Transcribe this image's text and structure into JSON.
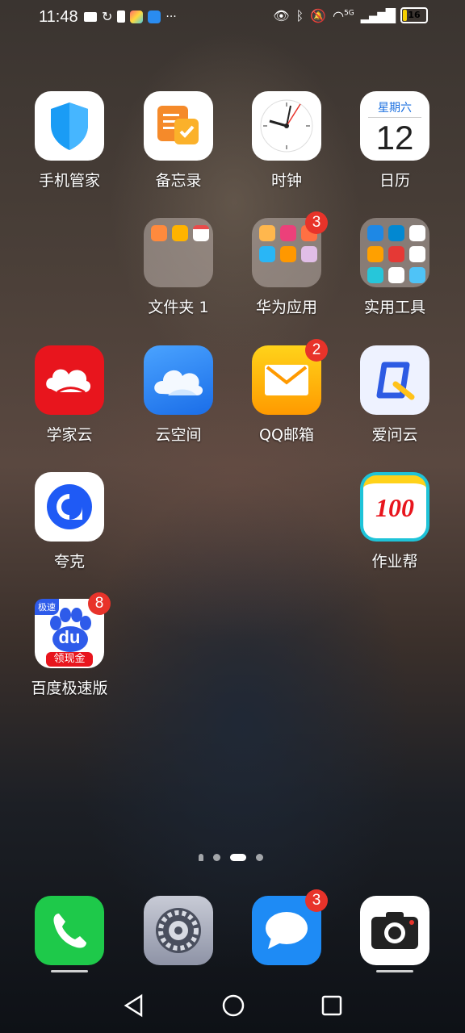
{
  "status_bar": {
    "time": "11:48",
    "network_label": "5G",
    "battery_level": "16"
  },
  "apps_row1": [
    {
      "label": "手机管家"
    },
    {
      "label": "备忘录"
    },
    {
      "label": "时钟"
    },
    {
      "label": "日历",
      "weekday": "星期六",
      "day": "12"
    }
  ],
  "apps_row2": [
    {
      "label": "文件夹 1"
    },
    {
      "label": "华为应用",
      "badge": "3"
    },
    {
      "label": "实用工具"
    }
  ],
  "apps_row3": [
    {
      "label": "学家云"
    },
    {
      "label": "云空间"
    },
    {
      "label": "QQ邮箱",
      "badge": "2"
    },
    {
      "label": "爱问云"
    }
  ],
  "apps_row4": [
    {
      "label": "夸克"
    },
    {
      "label": "作业帮",
      "icon_text": "100"
    }
  ],
  "apps_row5": [
    {
      "label": "百度极速版",
      "badge": "8",
      "icon_text": "du",
      "tag_top": "极速",
      "tag_bottom": "领现金"
    }
  ],
  "dock": [
    {
      "name": "phone"
    },
    {
      "name": "settings"
    },
    {
      "name": "messages",
      "badge": "3"
    },
    {
      "name": "camera"
    }
  ],
  "page_indicator": {
    "pages": 3,
    "current": 2
  },
  "colors": {
    "badge": "#e8332a",
    "phone_green": "#1ec94a",
    "messages_blue": "#1e8bf5"
  }
}
